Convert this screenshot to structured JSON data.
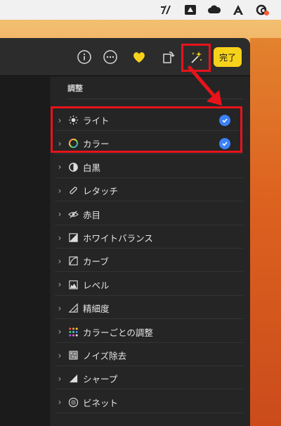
{
  "colors": {
    "accent": "#f7d21b",
    "check": "#3b82f6",
    "annotation": "#e8131b",
    "panel_bg": "#252525"
  },
  "menubar": {
    "icons": [
      "stats-icon",
      "drive-icon",
      "cloud-icon",
      "app-store-icon",
      "creative-cloud-icon"
    ]
  },
  "toolbar": {
    "info_icon": "info-icon",
    "more_icon": "more-icon",
    "favorite_icon": "heart-icon",
    "rotate_icon": "rotate-icon",
    "enhance_icon": "magic-wand-icon",
    "done_label": "完了"
  },
  "panel": {
    "title": "調整",
    "items": [
      {
        "label": "ライト",
        "icon": "sun-icon",
        "checked": true
      },
      {
        "label": "カラー",
        "icon": "color-wheel-icon",
        "checked": true
      },
      {
        "label": "白黒",
        "icon": "half-circle-icon",
        "checked": false
      },
      {
        "label": "レタッチ",
        "icon": "bandage-icon",
        "checked": false
      },
      {
        "label": "赤目",
        "icon": "eye-slash-icon",
        "checked": false
      },
      {
        "label": "ホワイトバランス",
        "icon": "white-balance-icon",
        "checked": false
      },
      {
        "label": "カーブ",
        "icon": "curve-icon",
        "checked": false
      },
      {
        "label": "レベル",
        "icon": "levels-icon",
        "checked": false
      },
      {
        "label": "精細度",
        "icon": "definition-icon",
        "checked": false
      },
      {
        "label": "カラーごとの調整",
        "icon": "dots-grid-icon",
        "checked": false
      },
      {
        "label": "ノイズ除去",
        "icon": "noise-icon",
        "checked": false
      },
      {
        "label": "シャープ",
        "icon": "sharpen-icon",
        "checked": false
      },
      {
        "label": "ビネット",
        "icon": "vignette-icon",
        "checked": false
      }
    ]
  }
}
